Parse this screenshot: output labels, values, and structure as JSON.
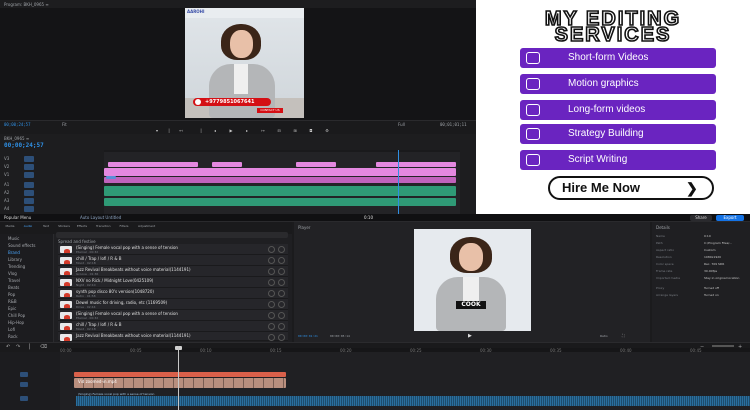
{
  "top_editor": {
    "program_tab": "Program: BKH_0965 ≡",
    "video_logo": "AAROHI",
    "phone": "+9779851067641",
    "contact_label": "CONTACT US",
    "monitor_timecode": "00;00;24;57",
    "fit_label": "Fit",
    "full_label": "Full",
    "duration": "00;01;01;11",
    "sequence_tab": "BKH_0965 ≡",
    "sequence_timecode": "00;00;24;57",
    "tracks": [
      "V3",
      "V2",
      "V1",
      "A1",
      "A2",
      "A3",
      "A4"
    ]
  },
  "promo": {
    "title_line_1": "MY EDITING",
    "title_line_2": "SERVICES",
    "services": [
      "Short-form Videos",
      "Motion graphics",
      "Long-form videos",
      "Strategy Building",
      "Script Writing"
    ],
    "cta": "Hire Me Now",
    "cta_arrow": "❯",
    "accent_color": "#6a24c0"
  },
  "bottom_editor": {
    "header": {
      "app_menu": "Popular Menu",
      "essentials": "Auto Layout Untitled",
      "workspace": "0:10",
      "share": "Share",
      "export": "Export"
    },
    "library_tabs": [
      "Media",
      "Audio",
      "Text",
      "Stickers",
      "Effects",
      "Transition",
      "Filters",
      "Adjustment"
    ],
    "sidebar": [
      "Music",
      "Sound effects",
      "Brand",
      "Library",
      "Trending",
      "Vlog",
      "Travel",
      "Beats",
      "Pop",
      "R&B",
      "Epic",
      "Chill Pop",
      "Hip-Hop",
      "Lofi",
      "Rock",
      "Folk",
      "Dance"
    ],
    "section_heading": "Spread and festive",
    "songs": [
      {
        "title": "(Singing) Female vocal pop with a sense of tension",
        "sub": "Eternal · 00:32"
      },
      {
        "title": "chill / Trap / lofi / R & B",
        "sub": "Mood · 02:18"
      },
      {
        "title": "Jazz Revival Breakbeats without voice material(1144191)",
        "sub": "Groove · 01:36"
      },
      {
        "title": "NXV no Rick / Midnight Love(0425109)",
        "sub": "Night · 02:10"
      },
      {
        "title": "synth pop disco 80's version(1048720)",
        "sub": "Retro · 01:58"
      },
      {
        "title": "Dewel music for driving, radio, etc (1169509)",
        "sub": "Drive · 02:44"
      },
      {
        "title": "(Singing) Female vocal pop with a sense of tension",
        "sub": "Eternal · 00:32"
      },
      {
        "title": "chill / Trap / lofi / R & B",
        "sub": "Mood · 02:18"
      },
      {
        "title": "Jazz Revival Breakbeats without voice material(1144191)",
        "sub": "Groove · 01:36"
      }
    ],
    "player": {
      "tab": "Player",
      "caption": "COOK",
      "timecode_current": "00:00:01:21",
      "timecode_total": "00:00:05:14",
      "ratio": "Ratio"
    },
    "details": {
      "tab": "Details",
      "rows": [
        {
          "key": "Name",
          "value": "0:10"
        },
        {
          "key": "Path",
          "value": "C:/Program Files/..."
        },
        {
          "key": "Aspect ratio",
          "value": "Custom"
        },
        {
          "key": "Resolution",
          "value": "1080x1920"
        },
        {
          "key": "Color space",
          "value": "Rec. 709 SDR"
        },
        {
          "key": "Frame rate",
          "value": "30.00fps"
        },
        {
          "key": "Imported media",
          "value": "Stay in original location"
        },
        {
          "key": "Proxy",
          "value": "Turned off"
        },
        {
          "key": "Arrange layers",
          "value": "Turned on"
        }
      ]
    },
    "timeline_tc": [
      "00:00",
      "00:05",
      "00:10",
      "00:15",
      "00:20",
      "00:25",
      "00:30",
      "00:35",
      "00:40",
      "00:45"
    ],
    "audio_label": "(Singing) Female vocal pop with a sense of tension",
    "video_track_label": "Vid zoomed-in.mp4"
  }
}
